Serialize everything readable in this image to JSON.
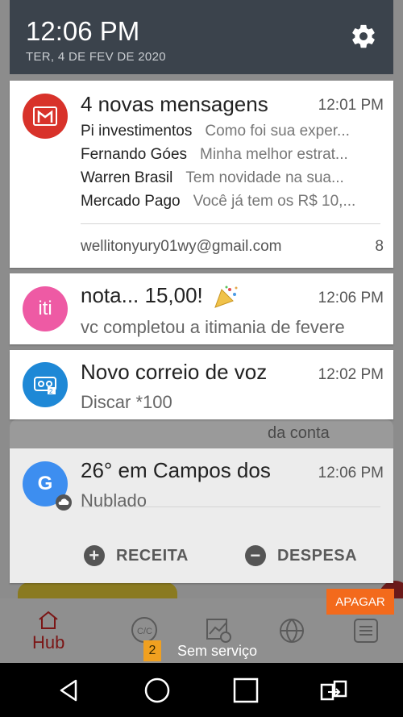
{
  "header": {
    "time": "12:06 PM",
    "date": "TER, 4 DE FEV DE 2020"
  },
  "gmail": {
    "title": "4 novas mensagens",
    "time": "12:01 PM",
    "messages": [
      {
        "sender": "Pi investimentos",
        "preview": "Como foi sua exper..."
      },
      {
        "sender": "Fernando Góes",
        "preview": "Minha melhor estrat..."
      },
      {
        "sender": "Warren Brasil",
        "preview": "Tem novidade na sua..."
      },
      {
        "sender": "Mercado Pago",
        "preview": "Você já tem os R$ 10,..."
      }
    ],
    "account": "wellitonyury01wy@gmail.com",
    "count": "8",
    "accent": "#d8322a"
  },
  "iti": {
    "avatar": "iti",
    "title": "nota... 15,00!",
    "time": "12:06 PM",
    "text": "vc completou a itimania de fevere",
    "accent": "#ee5aa4"
  },
  "voicemail": {
    "title": "Novo correio de voz",
    "time": "12:02 PM",
    "text": "Discar *100",
    "accent": "#1e88d6"
  },
  "google": {
    "avatar": "G",
    "title": "26° em Campos dos",
    "time": "12:06 PM",
    "text": "Nublado",
    "accent": "#3d8ef0",
    "actions": {
      "receita": "RECEITA",
      "despesa": "DESPESA"
    }
  },
  "background": {
    "partial_text": "da conta"
  },
  "clear_button": "APAGAR",
  "app_nav": {
    "hub": "Hub"
  },
  "status": {
    "sim": "2",
    "text": "Sem serviço"
  }
}
